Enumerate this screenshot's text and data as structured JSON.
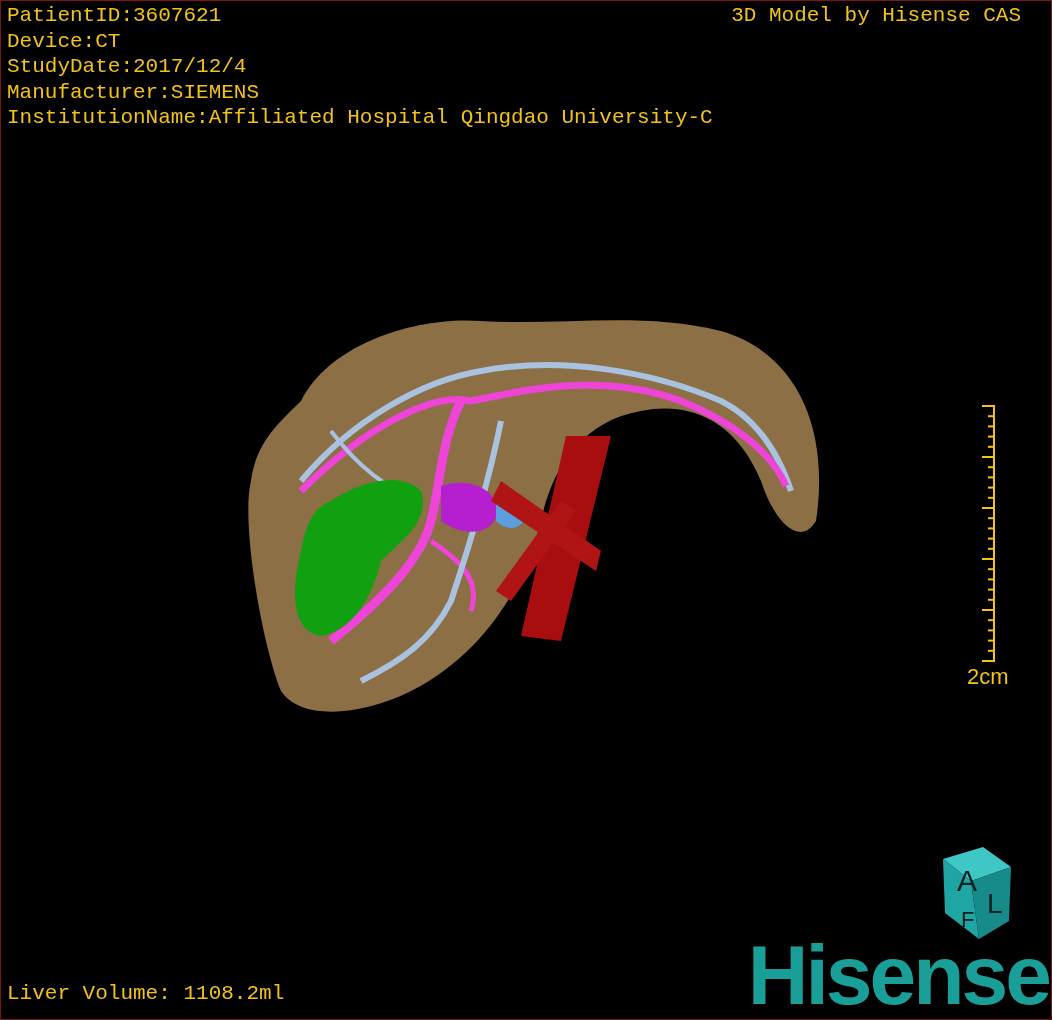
{
  "header": {
    "info_lines": [
      "PatientID:3607621",
      "Device:CT",
      "StudyDate:2017/12/4",
      "Manufacturer:SIEMENS",
      "InstitutionName:Affiliated Hospital Qingdao University-C"
    ],
    "caption": "3D Model by Hisense CAS"
  },
  "scale_bar": {
    "label": "2cm"
  },
  "footer": {
    "volume": "Liver Volume: 1108.2ml"
  },
  "orientation_cube": {
    "faces": [
      "A",
      "L",
      "F"
    ]
  },
  "logo": {
    "text": "Hisense"
  }
}
